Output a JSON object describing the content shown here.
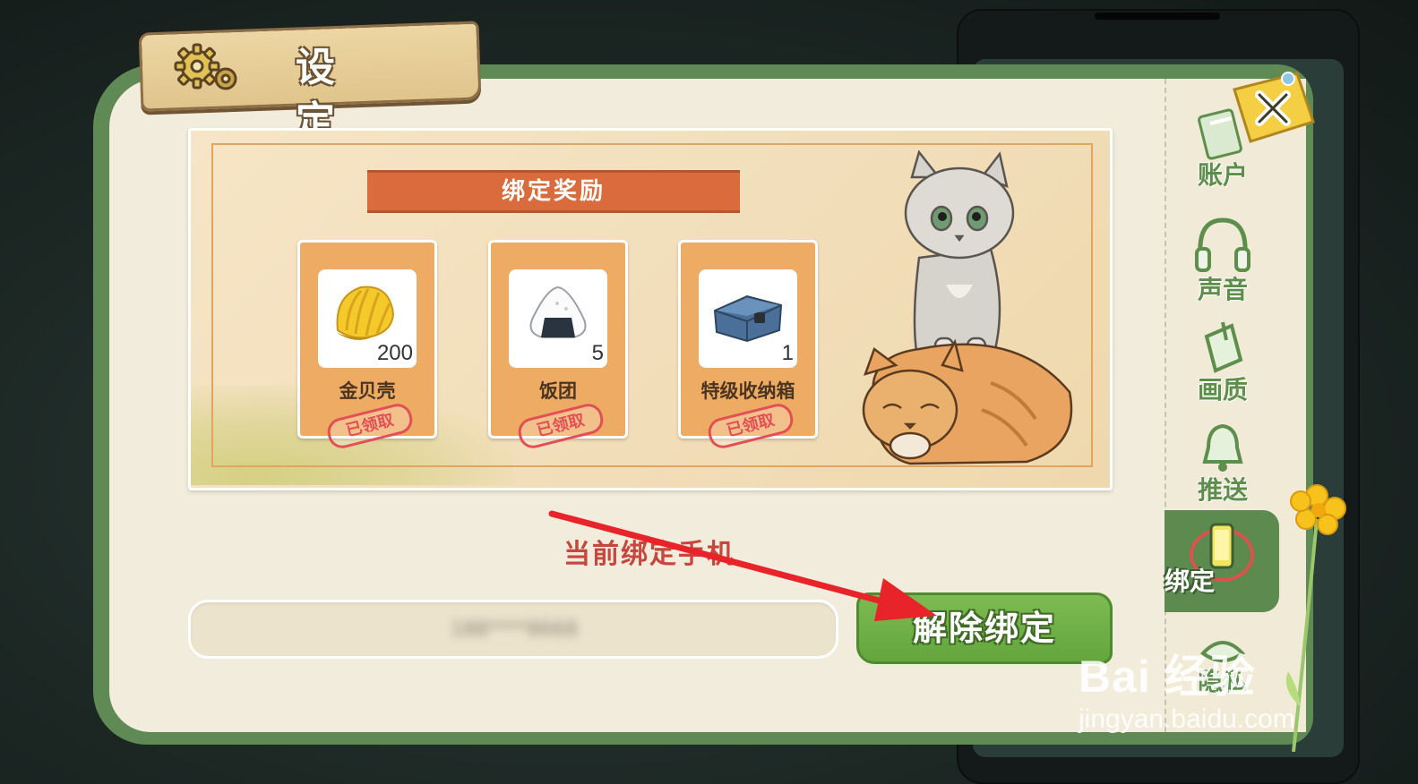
{
  "title": "设 定",
  "reward_section": {
    "banner": "绑定奖励",
    "items": [
      {
        "name": "金贝壳",
        "count": "200",
        "status": "已领取",
        "icon": "golden-shell-icon"
      },
      {
        "name": "饭团",
        "count": "5",
        "status": "已领取",
        "icon": "rice-ball-icon"
      },
      {
        "name": "特级收纳箱",
        "count": "1",
        "status": "已领取",
        "icon": "storage-box-icon"
      }
    ]
  },
  "binding": {
    "label": "当前绑定手机",
    "phone_value": "188****8668",
    "unbind_button": "解除绑定"
  },
  "side_tabs": [
    {
      "label": "账户",
      "icon": "account-card-icon"
    },
    {
      "label": "声音",
      "icon": "headphones-icon"
    },
    {
      "label": "画质",
      "icon": "picture-quality-icon"
    },
    {
      "label": "推送",
      "icon": "bell-icon"
    },
    {
      "label": "绑定",
      "icon": "phone-icon",
      "active": true
    },
    {
      "label": "隐私",
      "icon": "privacy-icon"
    }
  ],
  "watermark": {
    "main": "Bai 经验",
    "url": "jingyan.baidu.com"
  },
  "colors": {
    "panel_green": "#5f8a55",
    "banner_orange": "#d96b3d",
    "unbind_green": "#6aab41",
    "stamp_red": "#e24f55",
    "arrow_red": "#e8242a"
  }
}
